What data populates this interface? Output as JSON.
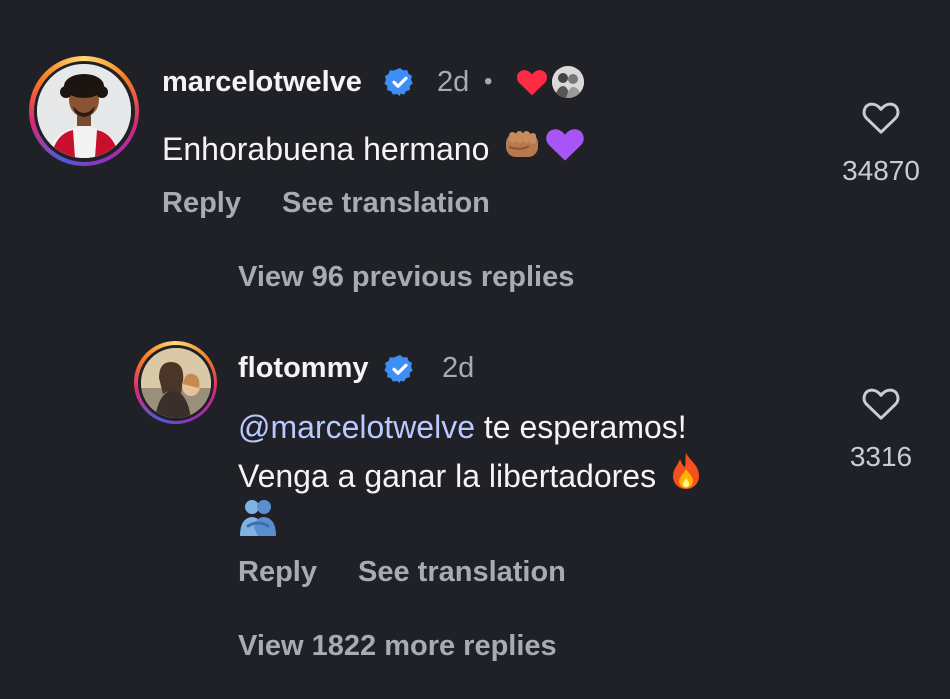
{
  "comment": {
    "username": "marcelotwelve",
    "time": "2d",
    "dot": "•",
    "text": "Enhorabuena hermano",
    "emojis": [
      "fist-icon",
      "purple-heart-icon"
    ],
    "reply_label": "Reply",
    "translate_label": "See translation",
    "like_count": "34870",
    "liked_by_author": true,
    "colors": {
      "heart_red": "#ff2b45",
      "verified_blue": "#3d8ef5",
      "purple_heart": "#a855f7"
    }
  },
  "view_previous": "View 96 previous replies",
  "reply": {
    "username": "flotommy",
    "time": "2d",
    "mention": "@marcelotwelve",
    "line1_rest": " te esperamos!",
    "line2": "Venga a ganar la libertadores",
    "emojis": [
      "fire-icon",
      "hugging-people-icon"
    ],
    "reply_label": "Reply",
    "translate_label": "See translation",
    "like_count": "3316"
  },
  "view_more": "View 1822 more replies"
}
